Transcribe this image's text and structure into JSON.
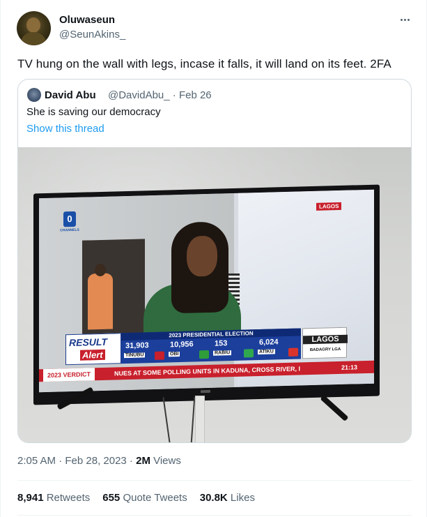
{
  "author": {
    "display_name": "Oluwaseun",
    "handle": "@SeunAkins_"
  },
  "tweet_text": "TV hung on the wall with legs, incase it falls, it will land on its feet. 2FA",
  "quoted": {
    "display_name": "David Abu",
    "handle_date": "@DavidAbu_ · Feb 26",
    "text": "She is saving our democracy",
    "show_thread": "Show this thread"
  },
  "tv_screen": {
    "channel_sub": "CHANNELS",
    "location_tag": "LAGOS",
    "result_alert_1": "RESULT",
    "result_alert_2": "Alert",
    "panel_title": "2023 PRESIDENTIAL ELECTION",
    "candidates": [
      {
        "votes": "31,903",
        "name": "TINUBU",
        "color": "#c8202c"
      },
      {
        "votes": "10,956",
        "name": "OBI",
        "color": "#2e9d3a"
      },
      {
        "votes": "153",
        "name": "RABIU",
        "color": "#2fa84f"
      },
      {
        "votes": "6,024",
        "name": "ATIKU",
        "color": "#d9342b"
      }
    ],
    "lga_state": "LAGOS",
    "lga_name": "BADAGRY LGA",
    "verdict": "2023 VERDICT",
    "ticker": "NUES AT SOME POLLING UNITS IN KADUNA, CROSS RIVER, I",
    "ticker_time": "21:13"
  },
  "meta": {
    "time_date": "2:05 AM · Feb 28, 2023 · ",
    "views_count": "2M",
    "views_label": " Views"
  },
  "stats": {
    "retweets_count": "8,941",
    "retweets_label": " Retweets",
    "quotes_count": "655",
    "quotes_label": " Quote Tweets",
    "likes_count": "30.8K",
    "likes_label": " Likes"
  },
  "colors": {
    "link": "#1d9bf0",
    "secondary_text": "#536471",
    "primary_text": "#0f1419"
  }
}
